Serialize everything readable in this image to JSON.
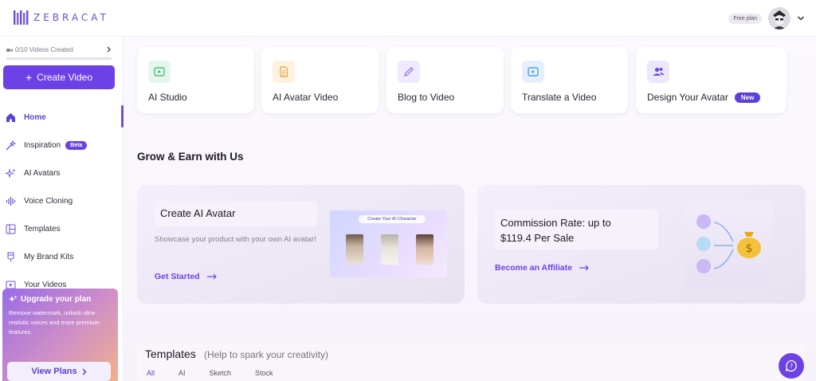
{
  "header": {
    "logo_text": "ZEBRACAT",
    "plan_label": "Free plan"
  },
  "sidebar": {
    "quota_text": "0/10 Videos Created",
    "quota_progress": 0.0,
    "create_label": "Create Video",
    "items": [
      {
        "label": "Home",
        "icon": "home-icon",
        "active": true
      },
      {
        "label": "Inspiration",
        "icon": "sparkle-wand-icon",
        "badge": "Beta"
      },
      {
        "label": "AI Avatars",
        "icon": "sparkles-icon"
      },
      {
        "label": "Voice Cloning",
        "icon": "waveform-icon"
      },
      {
        "label": "Templates",
        "icon": "layout-icon"
      },
      {
        "label": "My Brand Kits",
        "icon": "brand-kit-icon"
      },
      {
        "label": "Your Videos",
        "icon": "video-icon"
      }
    ],
    "upgrade": {
      "title": "Upgrade your plan",
      "description": "Remove watermark, unlock ultra-realistic voices and more premium features.",
      "button_label": "View Plans"
    }
  },
  "cards": [
    {
      "label": "AI Studio",
      "icon": "play-square-icon",
      "color": "#2fb36b",
      "bg": "#e6f6ec"
    },
    {
      "label": "AI Avatar Video",
      "icon": "document-icon",
      "color": "#e8a23a",
      "bg": "#fdf1e1"
    },
    {
      "label": "Blog to Video",
      "icon": "pencil-icon",
      "color": "#8a6ee6",
      "bg": "#efeafd"
    },
    {
      "label": "Translate a Video",
      "icon": "play-square-icon",
      "color": "#3a8ee8",
      "bg": "#e4f1fd"
    },
    {
      "label": "Design Your Avatar",
      "icon": "users-icon",
      "color": "#6c4ed8",
      "bg": "#ece7fc",
      "badge": "New"
    }
  ],
  "grow": {
    "title": "Grow & Earn with Us",
    "avatar_promo": {
      "title": "Create AI Avatar",
      "description": "Showcase your product with your own AI avatar!",
      "link": "Get Started",
      "preview_caption": "Create Your AI Character"
    },
    "affiliate_promo": {
      "title": "Commission Rate: up to $119.4 Per Sale",
      "link": "Become an Affiliate"
    }
  },
  "templates": {
    "title": "Templates",
    "hint": "(Help to spark your creativity)",
    "tabs": [
      "All",
      "AI",
      "Sketch",
      "Stock"
    ]
  },
  "colors": {
    "accent": "#6c41e6",
    "accent_text": "#5c3fd6"
  }
}
